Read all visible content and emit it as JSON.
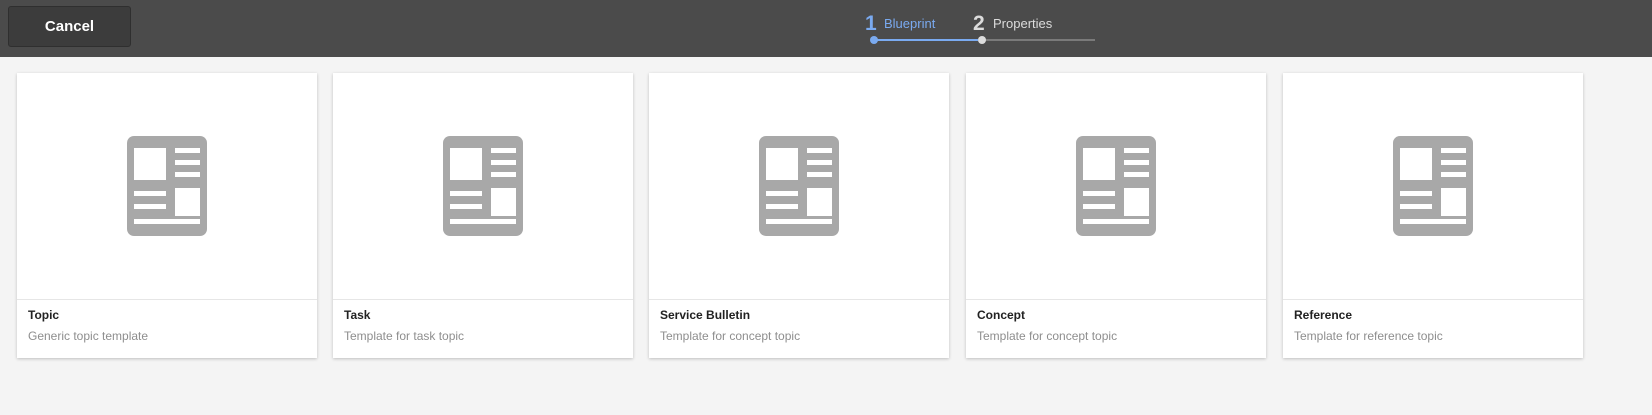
{
  "toolbar": {
    "cancel_label": "Cancel"
  },
  "wizard": {
    "steps": [
      {
        "number": "1",
        "label": "Blueprint",
        "state": "active"
      },
      {
        "number": "2",
        "label": "Properties",
        "state": "inactive"
      }
    ]
  },
  "templates": [
    {
      "title": "Topic",
      "description": "Generic topic template",
      "icon": "document-layout-icon"
    },
    {
      "title": "Task",
      "description": "Template for task topic",
      "icon": "document-layout-icon"
    },
    {
      "title": "Service Bulletin",
      "description": "Template for concept topic",
      "icon": "document-layout-icon"
    },
    {
      "title": "Concept",
      "description": "Template for concept topic",
      "icon": "document-layout-icon"
    },
    {
      "title": "Reference",
      "description": "Template for reference topic",
      "icon": "document-layout-icon"
    }
  ],
  "colors": {
    "topbar": "#4b4b4b",
    "accent": "#7aaaf0",
    "inactive_step": "#dcdcdc",
    "icon": "#a8a8a8"
  }
}
